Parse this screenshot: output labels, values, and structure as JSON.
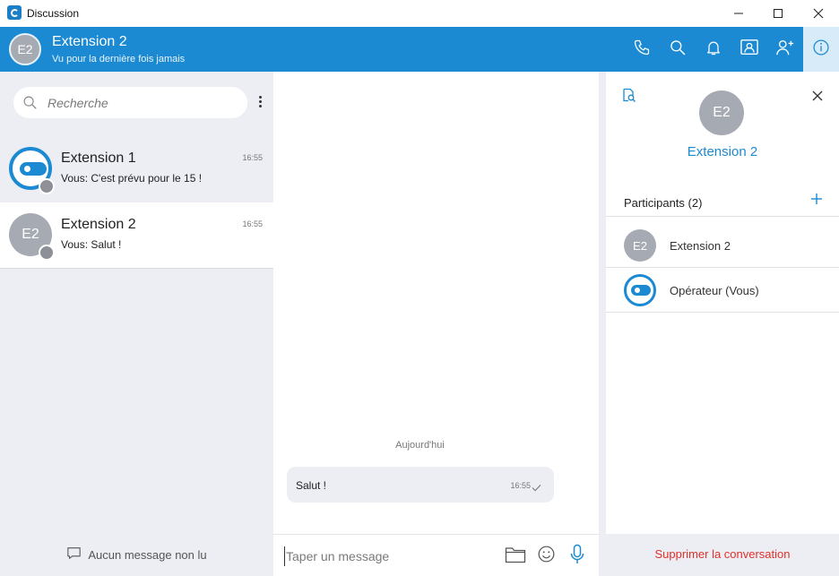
{
  "window": {
    "title": "Discussion"
  },
  "header": {
    "avatar_initials": "E2",
    "contact_name": "Extension 2",
    "status": "Vu pour la dernière fois jamais"
  },
  "search": {
    "placeholder": "Recherche"
  },
  "conversations": [
    {
      "name": "Extension 1",
      "time": "16:55",
      "last_message": "Vous: C'est prévu pour le 15 !",
      "avatar": "extension-logo"
    },
    {
      "name": "Extension 2",
      "time": "16:55",
      "last_message": "Vous: Salut !",
      "avatar_initials": "E2"
    }
  ],
  "left_footer": {
    "unread_label": "Aucun message non lu"
  },
  "chat": {
    "day_separator": "Aujourd'hui",
    "messages": [
      {
        "text": "Salut !",
        "time": "16:55",
        "status": "sent-check"
      }
    ]
  },
  "composer": {
    "placeholder": "Taper un message"
  },
  "info_panel": {
    "avatar_initials": "E2",
    "contact_name": "Extension 2",
    "participants_label": "Participants (2)",
    "participants": [
      {
        "name": "Extension 2",
        "avatar_initials": "E2"
      },
      {
        "name": "Opérateur (Vous)",
        "avatar": "extension-logo"
      }
    ],
    "delete_label": "Supprimer la conversation"
  },
  "colors": {
    "accent": "#1b8ad2",
    "panel_bg": "#eceef4",
    "avatar_grey": "#a6aab3",
    "danger": "#e0302a"
  }
}
